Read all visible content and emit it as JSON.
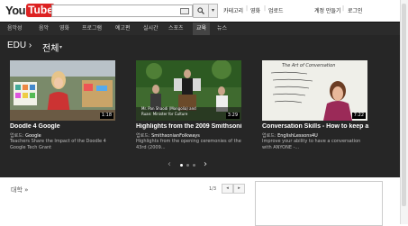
{
  "header": {
    "logo_you": "You",
    "logo_tube": "Tube",
    "dropdown_arrow": "▾",
    "nav": [
      "카테고리",
      "영화",
      "업로드"
    ],
    "account": [
      "계정 만들기",
      "로그인"
    ]
  },
  "categories": [
    {
      "label": "음악성",
      "active": false
    },
    {
      "label": "음악",
      "active": false
    },
    {
      "label": "영화",
      "active": false
    },
    {
      "label": "프로그램",
      "active": false
    },
    {
      "label": "예고편",
      "active": false
    },
    {
      "label": "실시간",
      "active": false
    },
    {
      "label": "스포츠",
      "active": false
    },
    {
      "label": "교육",
      "active": true
    },
    {
      "label": "뉴스",
      "active": false
    }
  ],
  "breadcrumb": {
    "section": "EDU",
    "sep": "›",
    "filter": "전체",
    "caret": "▾"
  },
  "cards": [
    {
      "title": "Doodle 4 Google",
      "by_label": "업로드:",
      "channel": "Google",
      "desc": "Teachers Share the Impact of the Doodle 4 Google Tech Grant",
      "duration": "1:18"
    },
    {
      "title": "Highlights from the 2009 Smithsoni",
      "by_label": "업로드:",
      "channel": "SmithsonianFolkways",
      "desc": "Highlights from the opening ceremonies of the 43rd (2009...",
      "duration": "3:29",
      "thumb_caption": [
        "Mr. Pan Shaodi (Mongolia) and",
        "Ruan: Minister for Culture"
      ]
    },
    {
      "title": "Conversation Skills - How to keep a",
      "by_label": "업로드:",
      "channel": "EnglishLessons4U",
      "desc": "Improve your ability to have a conversation with ANYONE -...",
      "duration": "7:22",
      "board": "The Art of Conversation"
    }
  ],
  "carousel": {
    "prev": "‹",
    "next": "›",
    "pages": 3,
    "current": 0
  },
  "bottom": {
    "section": "대학 »",
    "page": "1/3",
    "prev": "◂",
    "next": "▸"
  },
  "colors": {
    "brand_red": "#dd2222",
    "dark_bg": "#262626",
    "category_bar": "#2b2b2b"
  }
}
